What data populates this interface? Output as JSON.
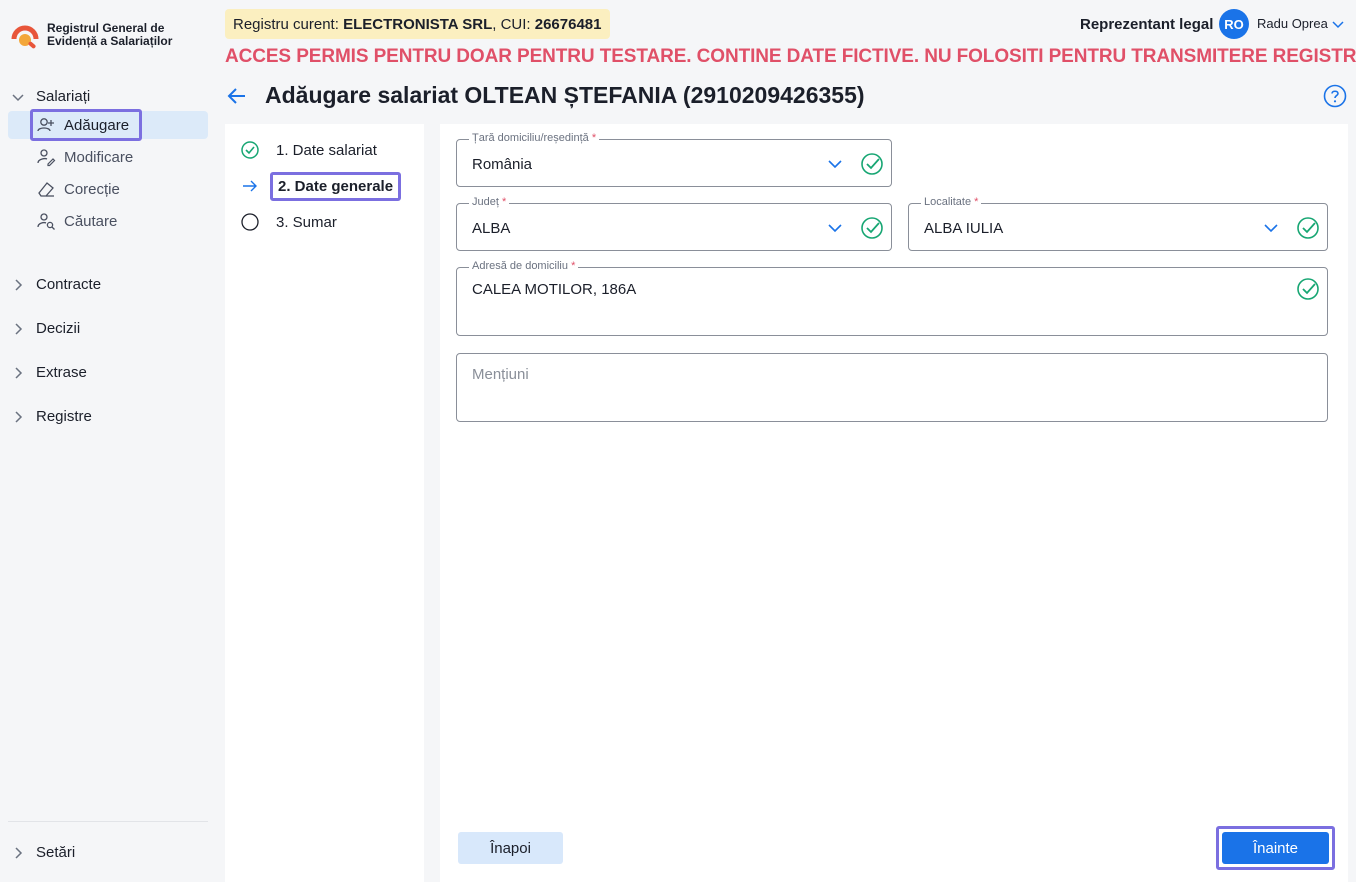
{
  "app": {
    "title_line1": "Registrul General de",
    "title_line2": "Evidență a Salariaților"
  },
  "sidebar": {
    "salariati": {
      "label": "Salariați",
      "items": [
        {
          "label": "Adăugare",
          "icon": "user-plus-icon"
        },
        {
          "label": "Modificare",
          "icon": "user-edit-icon"
        },
        {
          "label": "Corecție",
          "icon": "eraser-icon"
        },
        {
          "label": "Căutare",
          "icon": "user-search-icon"
        }
      ]
    },
    "groups": [
      "Contracte",
      "Decizii",
      "Extrase",
      "Registre"
    ],
    "settings": "Setări"
  },
  "topbar": {
    "registry_prefix": "Registru curent: ",
    "company": "ELECTRONISTA SRL",
    "cui_prefix": ", CUI: ",
    "cui": "26676481",
    "role": "Reprezentant legal",
    "avatar_initials": "RO",
    "user_name": "Radu Oprea",
    "warning": "ACCES PERMIS PENTRU DOAR PENTRU TESTARE. CONTINE DATE FICTIVE. NU FOLOSITI PENTRU TRANSMITERE REGISTRU"
  },
  "header": {
    "title": "Adăugare salariat OLTEAN ȘTEFANIA (2910209426355)"
  },
  "steps": [
    {
      "label": "1. Date salariat",
      "status": "done"
    },
    {
      "label": "2. Date generale",
      "status": "current"
    },
    {
      "label": "3. Sumar",
      "status": "pending"
    }
  ],
  "form": {
    "country": {
      "label": "Țară domiciliu/reședință",
      "required": "*",
      "value": "România"
    },
    "county": {
      "label": "Județ",
      "required": "*",
      "value": "ALBA"
    },
    "locality": {
      "label": "Localitate",
      "required": "*",
      "value": "ALBA IULIA"
    },
    "address": {
      "label": "Adresă de domiciliu",
      "required": "*",
      "value": "CALEA MOTILOR, 186A"
    },
    "mentions": {
      "placeholder": "Mențiuni"
    }
  },
  "buttons": {
    "back": "Înapoi",
    "next": "Înainte"
  },
  "colors": {
    "accent": "#1a73e8",
    "success": "#17a673",
    "warning": "#e05068",
    "focus": "#7b6fe0"
  }
}
